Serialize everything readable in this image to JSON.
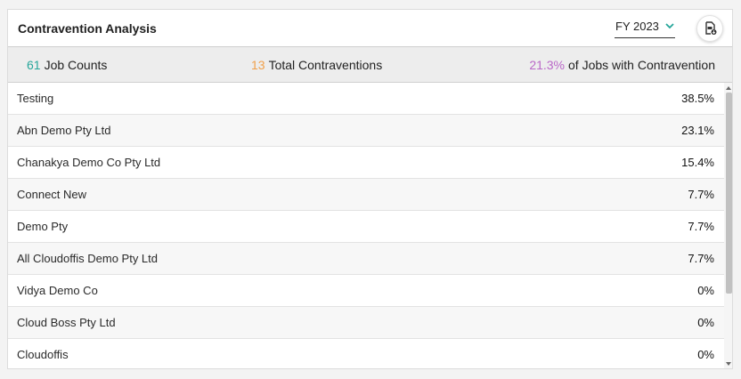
{
  "header": {
    "title": "Contravention Analysis",
    "fy_selected": "FY 2023",
    "export_icon": "pdf-export-icon"
  },
  "summary": {
    "job_counts_value": "61",
    "job_counts_label": "Job Counts",
    "total_contraventions_value": "13",
    "total_contraventions_label": "Total Contraventions",
    "pct_jobs_value": "21.3%",
    "pct_jobs_label": "of Jobs with Contravention"
  },
  "colors": {
    "job_counts": "#26a69a",
    "total_contraventions": "#f0a04b",
    "pct_jobs": "#ba68c8"
  },
  "rows": [
    {
      "name": "Testing",
      "pct": "38.5%"
    },
    {
      "name": "Abn Demo Pty Ltd",
      "pct": "23.1%"
    },
    {
      "name": "Chanakya Demo Co Pty Ltd",
      "pct": "15.4%"
    },
    {
      "name": "Connect New",
      "pct": "7.7%"
    },
    {
      "name": "Demo Pty",
      "pct": "7.7%"
    },
    {
      "name": "All Cloudoffis Demo Pty Ltd",
      "pct": "7.7%"
    },
    {
      "name": "Vidya Demo Co",
      "pct": "0%"
    },
    {
      "name": "Cloud Boss Pty Ltd",
      "pct": "0%"
    },
    {
      "name": "Cloudoffis",
      "pct": "0%"
    }
  ]
}
